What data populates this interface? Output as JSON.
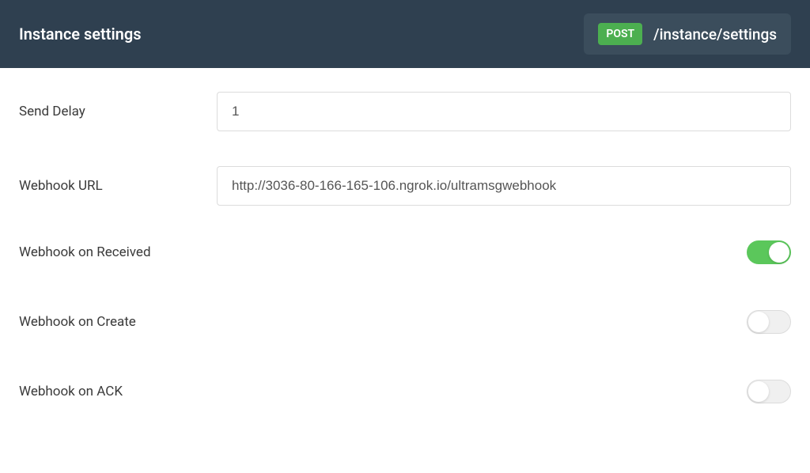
{
  "header": {
    "title": "Instance settings",
    "method": "POST",
    "endpoint": "/instance/settings"
  },
  "fields": {
    "send_delay": {
      "label": "Send Delay",
      "value": "1"
    },
    "webhook_url": {
      "label": "Webhook URL",
      "value": "http://3036-80-166-165-106.ngrok.io/ultramsgwebhook"
    },
    "webhook_received": {
      "label": "Webhook on Received",
      "enabled": true
    },
    "webhook_create": {
      "label": "Webhook on Create",
      "enabled": false
    },
    "webhook_ack": {
      "label": "Webhook on ACK",
      "enabled": false
    }
  }
}
